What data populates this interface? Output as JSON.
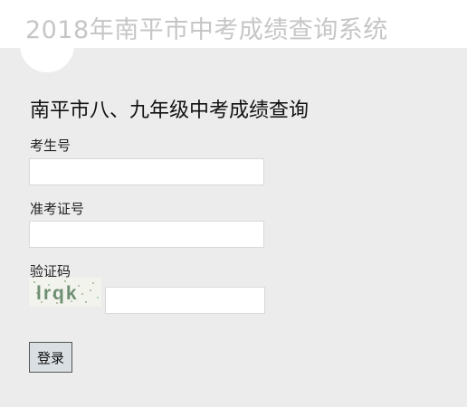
{
  "header": {
    "title": "2018年南平市中考成绩查询系统"
  },
  "form": {
    "heading": "南平市八、九年级中考成绩查询",
    "exam_number": {
      "label": "考生号",
      "value": ""
    },
    "admission_ticket": {
      "label": "准考证号",
      "value": ""
    },
    "captcha": {
      "label": "验证码",
      "image_text": "lrqk",
      "value": ""
    },
    "login_label": "登录"
  }
}
